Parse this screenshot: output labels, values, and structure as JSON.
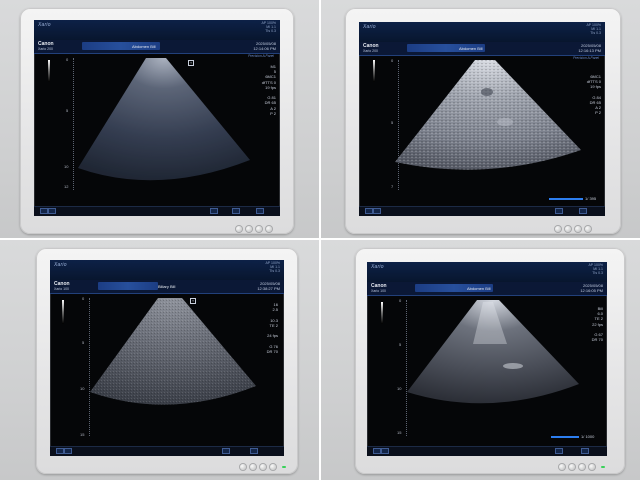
{
  "panels": [
    {
      "brand": "Xario",
      "logo": "Canon",
      "probe": "Xario 200",
      "exam": "Abdomen Bill",
      "stats": [
        "AP 100%",
        "MI 1.1",
        "TIs 0.3"
      ],
      "datetime": [
        "2025/05/08",
        "12:14:06 PM"
      ],
      "preset": "Precision  A.Panel",
      "params": [
        "M1",
        "5",
        "6MC1",
        "dfTTS 0",
        "19 fps",
        "",
        "G 81",
        "DR 65",
        "A 2",
        "P 2"
      ],
      "depth": [
        "0",
        "5",
        "10",
        "12"
      ]
    },
    {
      "brand": "Xario",
      "logo": "Canon",
      "probe": "Xario 200",
      "exam": "Abdomen Bill",
      "stats": [
        "AP 100%",
        "MI 1.1",
        "TIs 0.3"
      ],
      "datetime": [
        "2025/05/08",
        "12:16:13 PM"
      ],
      "preset": "Precision  A.Panel",
      "params": [
        "6MC1",
        "dfTTS 0",
        "19 fps",
        "",
        "G 84",
        "DR 65",
        "A 2",
        "P 2"
      ],
      "depth": [
        "0",
        "5",
        "7"
      ],
      "cine": "1/ 395"
    },
    {
      "brand": "Xario",
      "logo": "Canon",
      "probe": "Xario 100",
      "exam": "Biliary Bill",
      "stats": [
        "AP 100%",
        "MI 1.1",
        "TIs 0.3"
      ],
      "datetime": [
        "2025/05/08",
        "12:38:27 PM"
      ],
      "preset": "",
      "params": [
        "16",
        "2.5",
        "",
        "10.3",
        "TE 2",
        "",
        "24 fps",
        "",
        "G 76",
        "DR 70"
      ],
      "depth": [
        "0",
        "5",
        "10",
        "15"
      ]
    },
    {
      "brand": "Xario",
      "logo": "Canon",
      "probe": "Xario 100",
      "exam": "Abdomen Bill",
      "stats": [
        "AP 100%",
        "MI 1.1",
        "TIs 0.3"
      ],
      "datetime": [
        "2025/05/08",
        "12:16:05 PM"
      ],
      "preset": "",
      "params": [
        "Bill",
        "6.0",
        "TE 2",
        "22 fps",
        "",
        "G 67",
        "DR 70"
      ],
      "depth": [
        "0",
        "5",
        "10",
        "15"
      ],
      "cine": "1/ 1000"
    }
  ]
}
